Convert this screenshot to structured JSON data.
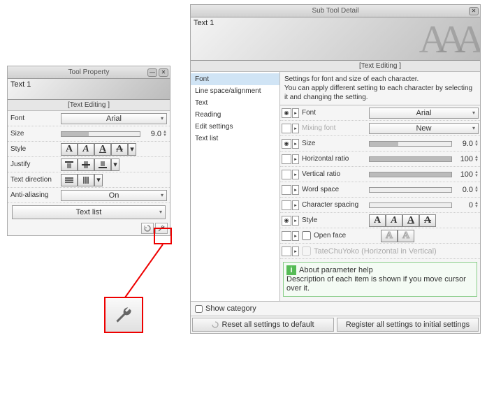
{
  "tp": {
    "title": "Tool Property",
    "banner": "Text 1",
    "section": "[Text Editing ]",
    "font_lbl": "Font",
    "font_val": "Arial",
    "size_lbl": "Size",
    "size_val": "9.0",
    "style_lbl": "Style",
    "justify_lbl": "Justify",
    "dir_lbl": "Text direction",
    "aa_lbl": "Anti-aliasing",
    "aa_val": "On",
    "textlist": "Text list"
  },
  "std": {
    "title": "Sub Tool Detail",
    "banner": "Text 1",
    "section": "[Text Editing ]",
    "cats": [
      "Font",
      "Line space/alignment",
      "Text",
      "Reading",
      "Edit settings",
      "Text list"
    ],
    "desc": "Settings for font and size of each character.\nYou can apply different setting to each character by selecting it and changing the setting.",
    "r": {
      "font_lbl": "Font",
      "font_val": "Arial",
      "mix_lbl": "Mixing font",
      "mix_val": "New",
      "size_lbl": "Size",
      "size_val": "9.0",
      "hr_lbl": "Horizontal ratio",
      "hr_val": "100",
      "vr_lbl": "Vertical ratio",
      "vr_val": "100",
      "ws_lbl": "Word space",
      "ws_val": "0.0",
      "cs_lbl": "Character spacing",
      "cs_val": "0",
      "style_lbl": "Style",
      "of_lbl": "Open face",
      "tcy_lbl": "TateChuYoko (Horizontal in Vertical)"
    },
    "help_t": "About parameter help",
    "help_b": "Description of each item is shown if you move cursor over it.",
    "showcat": "Show category",
    "reset": "Reset all settings to default",
    "register": "Register all settings to initial settings"
  }
}
